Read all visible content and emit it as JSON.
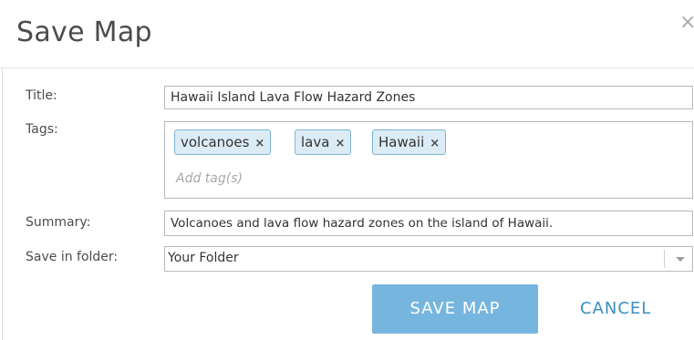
{
  "dialog": {
    "title": "Save Map",
    "close_glyph": "×"
  },
  "form": {
    "title_label": "Title:",
    "title_value": "Hawaii Island Lava Flow Hazard Zones",
    "tags_label": "Tags:",
    "tags": [
      {
        "label": "volcanoes"
      },
      {
        "label": "lava"
      },
      {
        "label": "Hawaii"
      }
    ],
    "tag_remove_glyph": "×",
    "tags_placeholder": "Add tag(s)",
    "summary_label": "Summary:",
    "summary_value": "Volcanoes and lava flow hazard zones on the island of Hawaii.",
    "folder_label": "Save in folder:",
    "folder_value": "Your Folder"
  },
  "actions": {
    "save_label": "SAVE MAP",
    "cancel_label": "CANCEL"
  },
  "colors": {
    "primary_button": "#76b6de",
    "link": "#3a8fc7",
    "tag_bg": "#dcecf7",
    "tag_border": "#7fb4d4"
  },
  "icons": {
    "close": "close-icon",
    "tag_remove": "tag-remove-icon",
    "dropdown": "chevron-down-icon"
  }
}
